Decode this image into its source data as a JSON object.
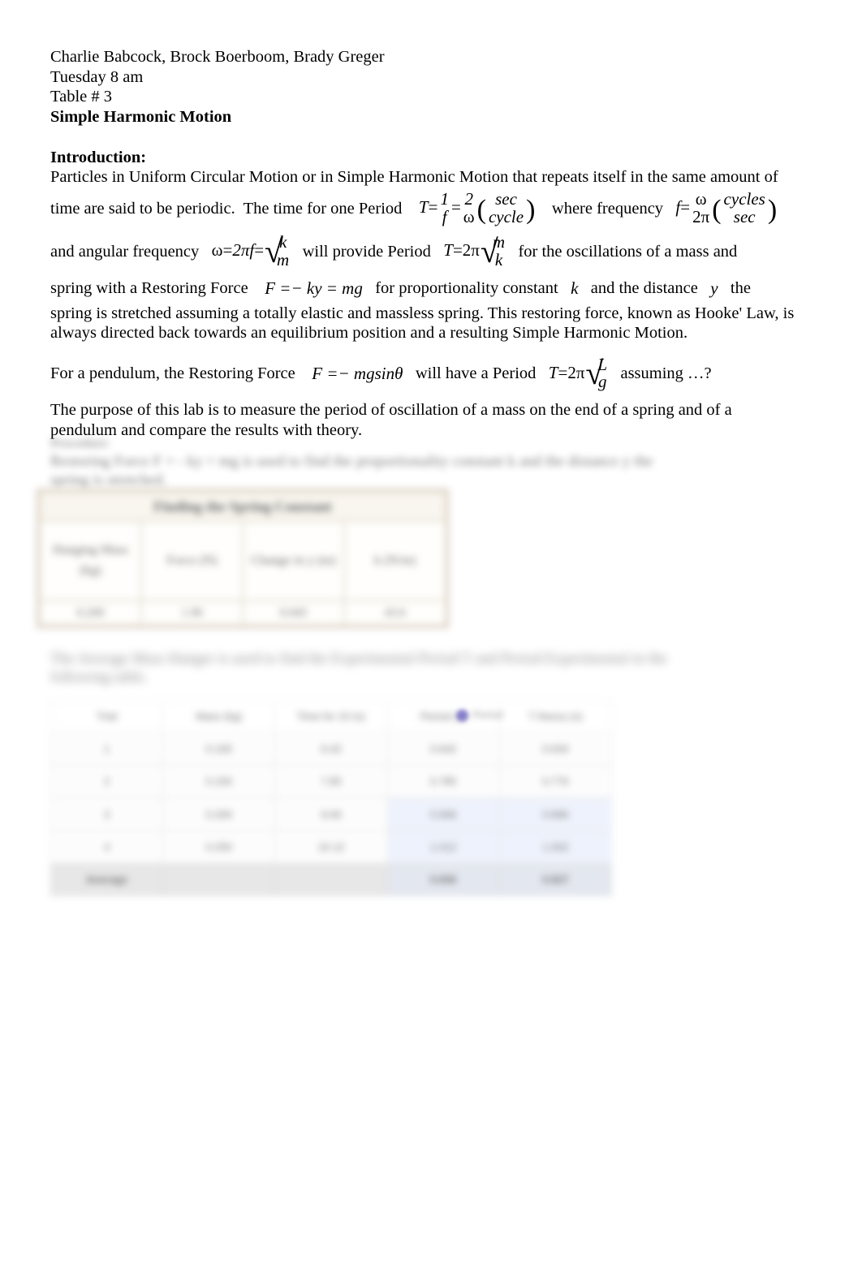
{
  "document": {
    "header": {
      "authors": "Charlie Babcock, Brock Boerboom, Brady Greger",
      "session": "Tuesday 8 am",
      "table_number": "Table # 3",
      "title": "Simple Harmonic Motion"
    },
    "introduction": {
      "heading": "Introduction:",
      "p1_a": "Particles in Uniform Circular Motion or in Simple Harmonic Motion that repeats itself in the same amount of",
      "p1_b": "time are said to be periodic.  The time for one Period",
      "p1_c": "where frequency",
      "p2_a": "and angular frequency",
      "p2_b": "will provide Period",
      "p2_c": "for the oscillations of a mass and",
      "p3_a": "spring with a Restoring Force",
      "p3_b": "for proportionality constant",
      "p3_c": "and the distance",
      "p3_d": "the",
      "p4": "spring is stretched assuming a totally elastic and massless spring.  This restoring force, known as Hooke' Law, is",
      "p5": "always directed back towards an equilibrium position and a resulting Simple Harmonic Motion.",
      "p6_a": "For a pendulum, the Restoring Force",
      "p6_b": "will have a Period",
      "p6_c": "assuming …?",
      "p7_a": "The purpose of this lab is to measure the period of oscillation of a mass on the end of a spring and of a",
      "p7_b": "pendulum and compare the results with theory."
    },
    "equations": {
      "period_T": {
        "lhs": "T",
        "eq1": "=",
        "n1": "1",
        "d1": "f",
        "eq2": "=",
        "n2": "2",
        "d2": "ω",
        "unit_num": "sec",
        "unit_den": "cycle"
      },
      "frequency_f": {
        "lhs": "f",
        "eq": "=",
        "num": "ω",
        "den": "2π",
        "unit_num": "cycles",
        "unit_den": "sec"
      },
      "omega": {
        "lhs": "ω",
        "eq1": "=",
        "mid": "2πf",
        "eq2": "=",
        "rad_num": "k",
        "rad_den": "m"
      },
      "period_spring": {
        "lhs": "T",
        "eq": "=",
        "coef": "2π",
        "rad_num": "m",
        "rad_den": "k"
      },
      "hookes_law": "F =− ky = mg",
      "const_k": "k",
      "distance_y": "y",
      "pendulum_force": "F =− mgsinθ",
      "period_pendulum": {
        "lhs": "T",
        "eq": "=",
        "coef": "2π",
        "rad_num": "L",
        "rad_den": "g"
      }
    },
    "procedure": {
      "heading": "Procedure:",
      "line1": "Restoring Force   F = - ky = mg   is used to find the proportionality constant   k   and the distance   y   the",
      "line2": "spring is stretched."
    },
    "spring_table": {
      "caption": "Finding the Spring Constant",
      "headers": [
        "Hanging Mass (kg)",
        "Force (N)",
        "Change in y (m)",
        "k (N/m)"
      ],
      "values": [
        "0.200",
        "1.96",
        "0.045",
        "43.6"
      ]
    },
    "mid_note": {
      "line1": "The Average Mass Hanger is used to find the Experimental Period T and Period Experimental in the",
      "line2": "following table."
    },
    "data_table": {
      "legend_label": "Period",
      "columns": [
        "Trial",
        "Mass (kg)",
        "Time for 10 (s)",
        "Period (s)",
        "T theory (s)"
      ],
      "rows": [
        [
          "1",
          "0.100",
          "6.42",
          "0.642",
          "0.634"
        ],
        [
          "2",
          "0.150",
          "7.85",
          "0.785",
          "0.776"
        ],
        [
          "3",
          "0.200",
          "9.06",
          "0.906",
          "0.896"
        ],
        [
          "4",
          "0.250",
          "10.12",
          "1.012",
          "1.002"
        ]
      ],
      "footer": [
        "Average",
        "",
        "",
        "0.836",
        "0.827"
      ]
    },
    "colors": {
      "page_background": "#ffffff",
      "text": "#000000",
      "spring_table_border": "#cbbda8",
      "data_table_highlight": "#e8eefb",
      "data_table_footer": "#dedede",
      "legend_marker": "#6b63c4"
    }
  }
}
